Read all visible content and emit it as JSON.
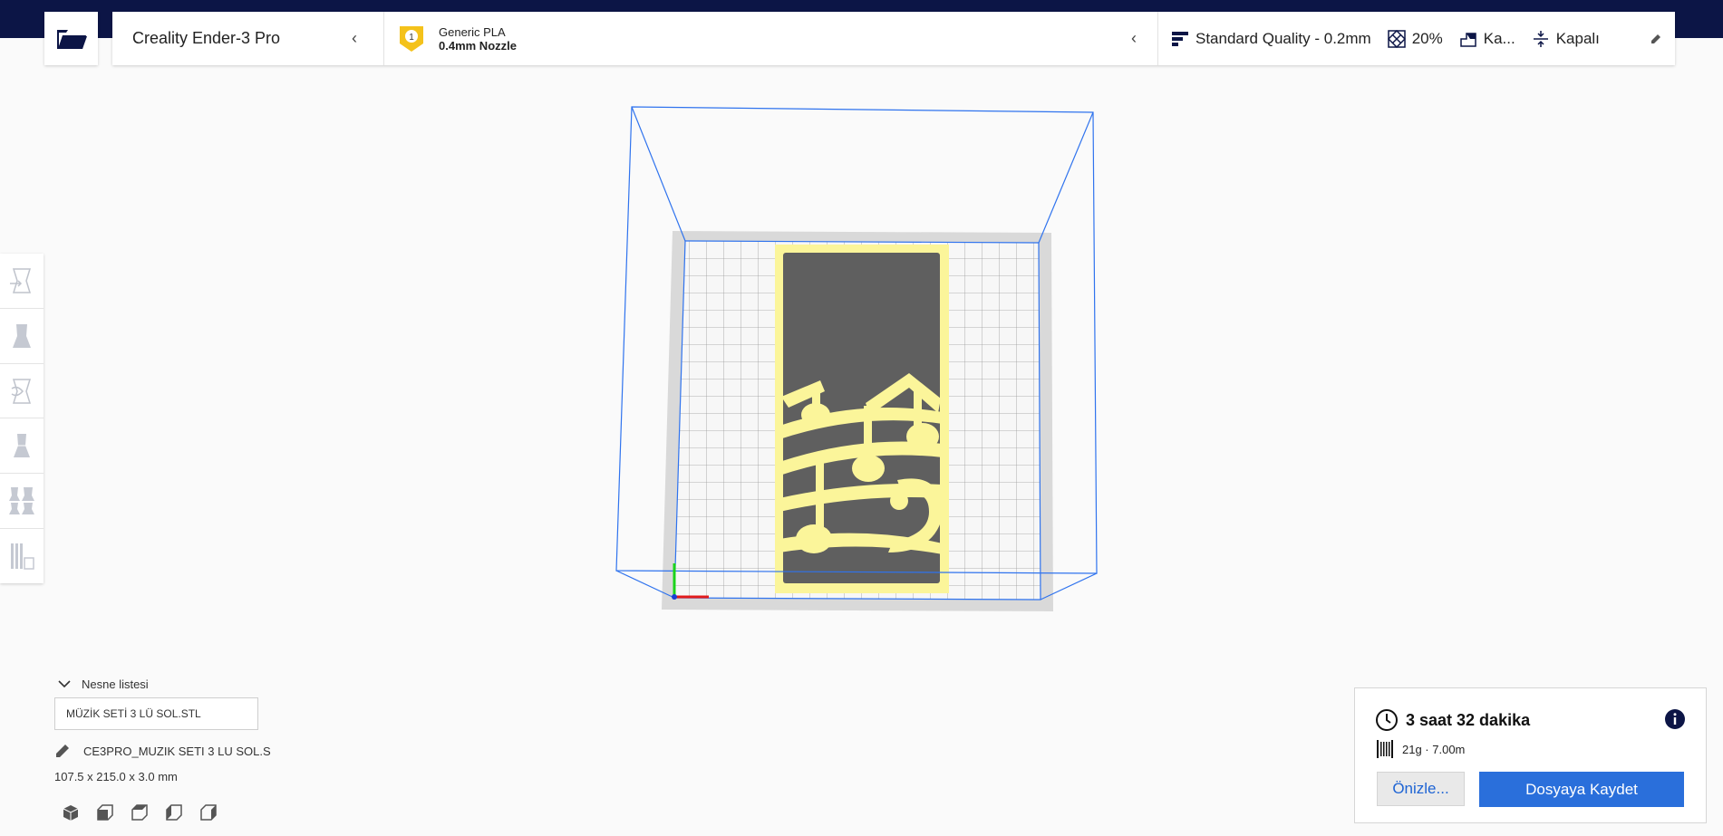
{
  "header": {
    "printer_name": "Creality Ender-3 Pro",
    "material": {
      "extruder_number": "1",
      "name": "Generic PLA",
      "nozzle": "0.4mm Nozzle"
    },
    "settings": {
      "quality": "Standard Quality - 0.2mm",
      "infill": "20%",
      "support": "Ka...",
      "adhesion": "Kapalı"
    }
  },
  "object_panel": {
    "header": "Nesne listesi",
    "objects": [
      "MÜZİK SETİ 3 LÜ SOL.STL"
    ],
    "job_name": "CE3PRO_MUZIK SETI 3 LU SOL.S",
    "dimensions": "107.5 x 215.0 x 3.0 mm"
  },
  "print_panel": {
    "time": "3 saat 32 dakika",
    "material_usage": "21g · 7.00m",
    "preview_label": "Önizle...",
    "save_label": "Dosyaya Kaydet"
  },
  "colors": {
    "accent": "#2a6fdb",
    "top_strip": "#0c1546",
    "model": "#fbf59a",
    "build_volume": "#2f73ee",
    "badge": "#f4c21b"
  }
}
